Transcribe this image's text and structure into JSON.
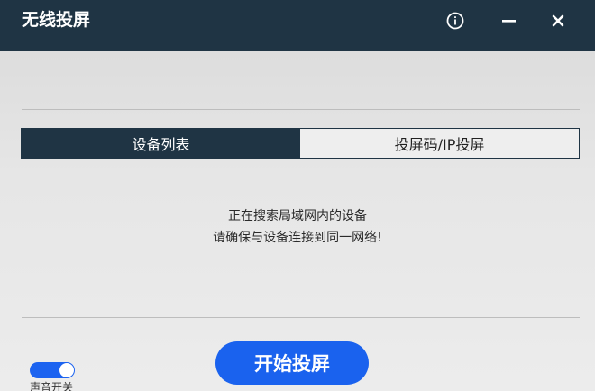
{
  "titlebar": {
    "title": "无线投屏",
    "background_color": "#1f3444",
    "buttons": {
      "info_icon": "info-circle-icon",
      "minimize_icon": "minimize-icon",
      "close_icon": "close-icon"
    }
  },
  "tabs": [
    {
      "label": "设备列表",
      "active": true
    },
    {
      "label": "投屏码/IP投屏",
      "active": false
    }
  ],
  "status_message": {
    "line1": "正在搜索局域网内的设备",
    "line2": "请确保与设备连接到同一网络!"
  },
  "sound_toggle": {
    "label": "声音开关",
    "on": true,
    "color": "#1c63f0"
  },
  "start_button": {
    "label": "开始投屏",
    "color": "#1a62ee"
  }
}
